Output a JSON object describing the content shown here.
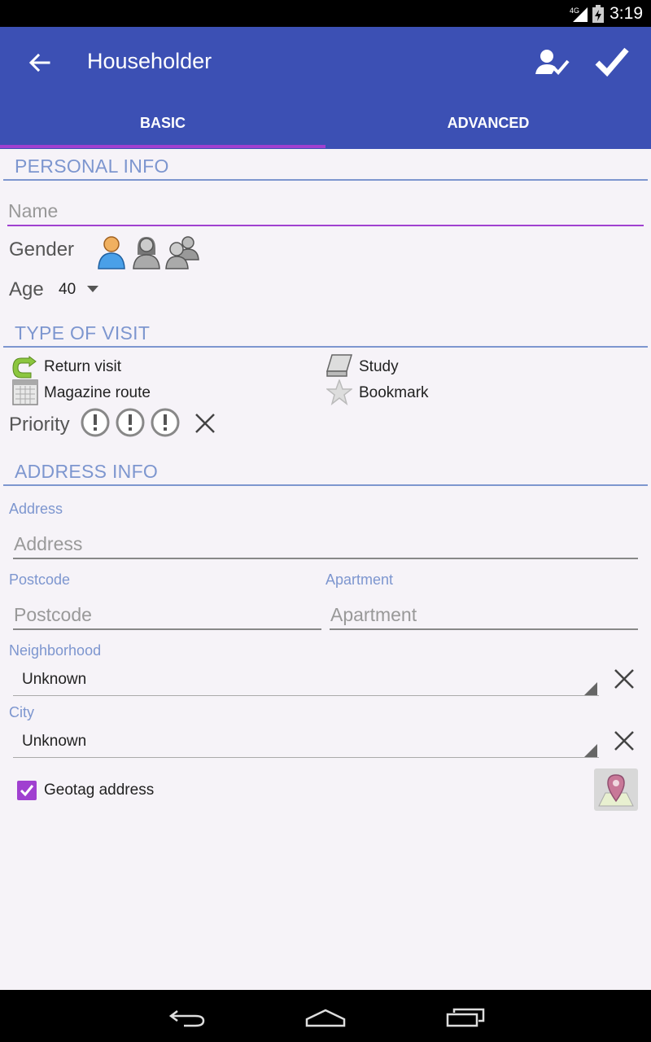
{
  "status": {
    "time": "3:19",
    "network": "4G"
  },
  "appbar": {
    "title": "Householder"
  },
  "tabs": [
    {
      "label": "BASIC"
    },
    {
      "label": "ADVANCED"
    }
  ],
  "personal": {
    "heading": "PERSONAL INFO",
    "name_placeholder": "Name",
    "gender_label": "Gender",
    "age_label": "Age",
    "age_value": "40"
  },
  "visit": {
    "heading": "TYPE OF VISIT",
    "options": [
      "Return visit",
      "Study",
      "Magazine route",
      "Bookmark"
    ],
    "priority_label": "Priority"
  },
  "address": {
    "heading": "ADDRESS INFO",
    "address_caption": "Address",
    "address_placeholder": "Address",
    "postcode_caption": "Postcode",
    "postcode_placeholder": "Postcode",
    "apartment_caption": "Apartment",
    "apartment_placeholder": "Apartment",
    "neighborhood_caption": "Neighborhood",
    "neighborhood_value": "Unknown",
    "city_caption": "City",
    "city_value": "Unknown",
    "geotag_label": "Geotag address",
    "geotag_checked": true
  },
  "colors": {
    "primary": "#3c50b4",
    "accent": "#a040d0",
    "section": "#7d96cf",
    "background": "#f6f3f8"
  }
}
